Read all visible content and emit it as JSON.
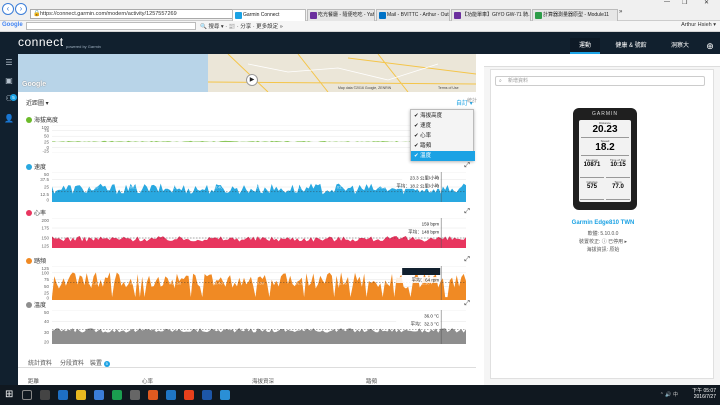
{
  "browser": {
    "url": "https://connect.garmin.com/modern/activity/1257557269",
    "tabs": [
      {
        "label": "Garmin Connect",
        "color": "#1ba2e4",
        "active": true
      },
      {
        "label": "吃光餐廳 - 隨便吃吃 - Yahoo...",
        "color": "#6b2f9e",
        "active": false
      },
      {
        "label": "Mail - BVITTC - Arthur - Outl...",
        "color": "#0072c6",
        "active": false
      },
      {
        "label": "【功能單車】GIYO GW-71 騎...",
        "color": "#6b2f9e",
        "active": false
      },
      {
        "label": "計算器測量器原型 - Module11",
        "color": "#2d9c48",
        "active": false
      }
    ],
    "tab_overflow": "»",
    "window_controls": [
      "—",
      "❐",
      "✕"
    ],
    "google_label": "Google",
    "bookmark_items": "🔍 搜尋 ▾  ·  📰  ·  分享  ·  更多設定 »",
    "user": "Arthur Hsieh ▾"
  },
  "app": {
    "logo": "connect",
    "logo_sub": "powered by Garmin",
    "top_tabs": [
      {
        "label": "運動",
        "active": true
      },
      {
        "label": "健康 & 號館",
        "active": false
      },
      {
        "label": "洞察大",
        "active": false
      }
    ],
    "plus_icon": "⊕",
    "sidebar_badge": "5"
  },
  "map": {
    "google_logo": "Google",
    "credit": "Map data ©2016 Google, ZENRIN",
    "terms": "Terms of Use"
  },
  "graph_controls": {
    "select_label": "近距圖",
    "custom_label": "自訂"
  },
  "panel_header": {
    "label": "統計"
  },
  "dropdown": {
    "items": [
      {
        "label": "海拔高度",
        "checked": true,
        "selected": false
      },
      {
        "label": "速度",
        "checked": true,
        "selected": false
      },
      {
        "label": "心率",
        "checked": true,
        "selected": false
      },
      {
        "label": "踏頻",
        "checked": true,
        "selected": false
      },
      {
        "label": "溫度",
        "checked": true,
        "selected": true
      }
    ]
  },
  "chart_data": [
    {
      "type": "area",
      "title": "海拔高度",
      "color": "#6cbb2a",
      "ylim": [
        -25,
        100
      ],
      "yticks": [
        100,
        75,
        50,
        25,
        0,
        -25
      ],
      "x_ticks": [
        "00:10",
        "00:20",
        "00:30",
        "00:40",
        "00:50",
        "01:00",
        "01:10",
        "01:20",
        "01:30"
      ],
      "baseline": 25,
      "level": 27,
      "noise": 2
    },
    {
      "type": "area",
      "title": "速度",
      "color": "#29a8e0",
      "ylim": [
        0,
        50
      ],
      "yticks": [
        50,
        37.5,
        25,
        12.5,
        0
      ],
      "x_ticks": [
        "00:10",
        "00:20",
        "00:30",
        "00:40",
        "00:50",
        "01:00",
        "01:10",
        "01:20",
        "01:30"
      ],
      "baseline": 0,
      "level": 22,
      "noise": 9,
      "avg": 17,
      "tooltip": "23.3 公里/小時",
      "tooltip_avg": "平均：18.2 公里/小時"
    },
    {
      "type": "area",
      "title": "心率",
      "color": "#e8365f",
      "ylim": [
        125,
        200
      ],
      "yticks": [
        200,
        175,
        150,
        125
      ],
      "x_ticks": [
        "00:10",
        "00:20",
        "00:30",
        "00:40",
        "00:50",
        "01:00",
        "01:10",
        "01:20",
        "01:30"
      ],
      "baseline": 125,
      "level": 148,
      "noise": 7,
      "avg": 150,
      "tooltip": "159 bpm",
      "tooltip_avg": "平均：148 bpm"
    },
    {
      "type": "area",
      "title": "踏頻",
      "color": "#f08a24",
      "ylim": [
        0,
        125
      ],
      "yticks": [
        125,
        100,
        75,
        50,
        25,
        0
      ],
      "x_ticks": [
        "00:10",
        "00:20",
        "00:30",
        "00:40",
        "00:50",
        "01:00",
        "01:10",
        "01:20",
        "01:30"
      ],
      "baseline": 0,
      "level": 72,
      "noise": 30,
      "avg": 64,
      "tooltip": "50:59 公裡",
      "tooltip_avg": "平均：64 rpm"
    },
    {
      "type": "area",
      "title": "溫度",
      "color": "#8e8e8e",
      "ylim": [
        20,
        50
      ],
      "yticks": [
        50,
        40,
        30,
        20
      ],
      "x_ticks": [
        "00:10",
        "00:20",
        "00:30",
        "00:40",
        "00:50",
        "01:00",
        "01:10",
        "01:20",
        "01:30"
      ],
      "baseline": 20,
      "level": 32,
      "noise": 2,
      "avg": 33,
      "tooltip": "36.0 °C",
      "tooltip_avg": "平均：32.3 °C"
    }
  ],
  "device": {
    "brand": "GARMIN",
    "fields": [
      {
        "label": "Distance",
        "value": "20.23",
        "unit": "km"
      },
      {
        "label": "Speed",
        "value": "18.2",
        "unit": "kph"
      },
      {
        "label": "Elevation",
        "value": "10871"
      },
      {
        "label": "Time of Day",
        "value": "10:15"
      },
      {
        "label": "Calories",
        "value": "575"
      },
      {
        "label": "Temp",
        "value": "77.0"
      }
    ],
    "name": "Garmin Edge810 TWN",
    "firmware": "軟體: 5.10.0.0",
    "calibration": "裝置校正: ⓘ 已停用 ▸",
    "source": "海拔資訊: 原始"
  },
  "search": {
    "placeholder": "新增資料"
  },
  "bottom_tabs": [
    {
      "label": "統計資料"
    },
    {
      "label": "分段資料"
    },
    {
      "label": "裝置"
    }
  ],
  "bottom_tab_badge": "5",
  "stats_labels": [
    "距離",
    "心率",
    "海拔資深",
    "踏頻"
  ],
  "taskbar": {
    "time": "下午 05:07",
    "date": "2016/7/27",
    "tray": "⌃  🔊  中"
  }
}
